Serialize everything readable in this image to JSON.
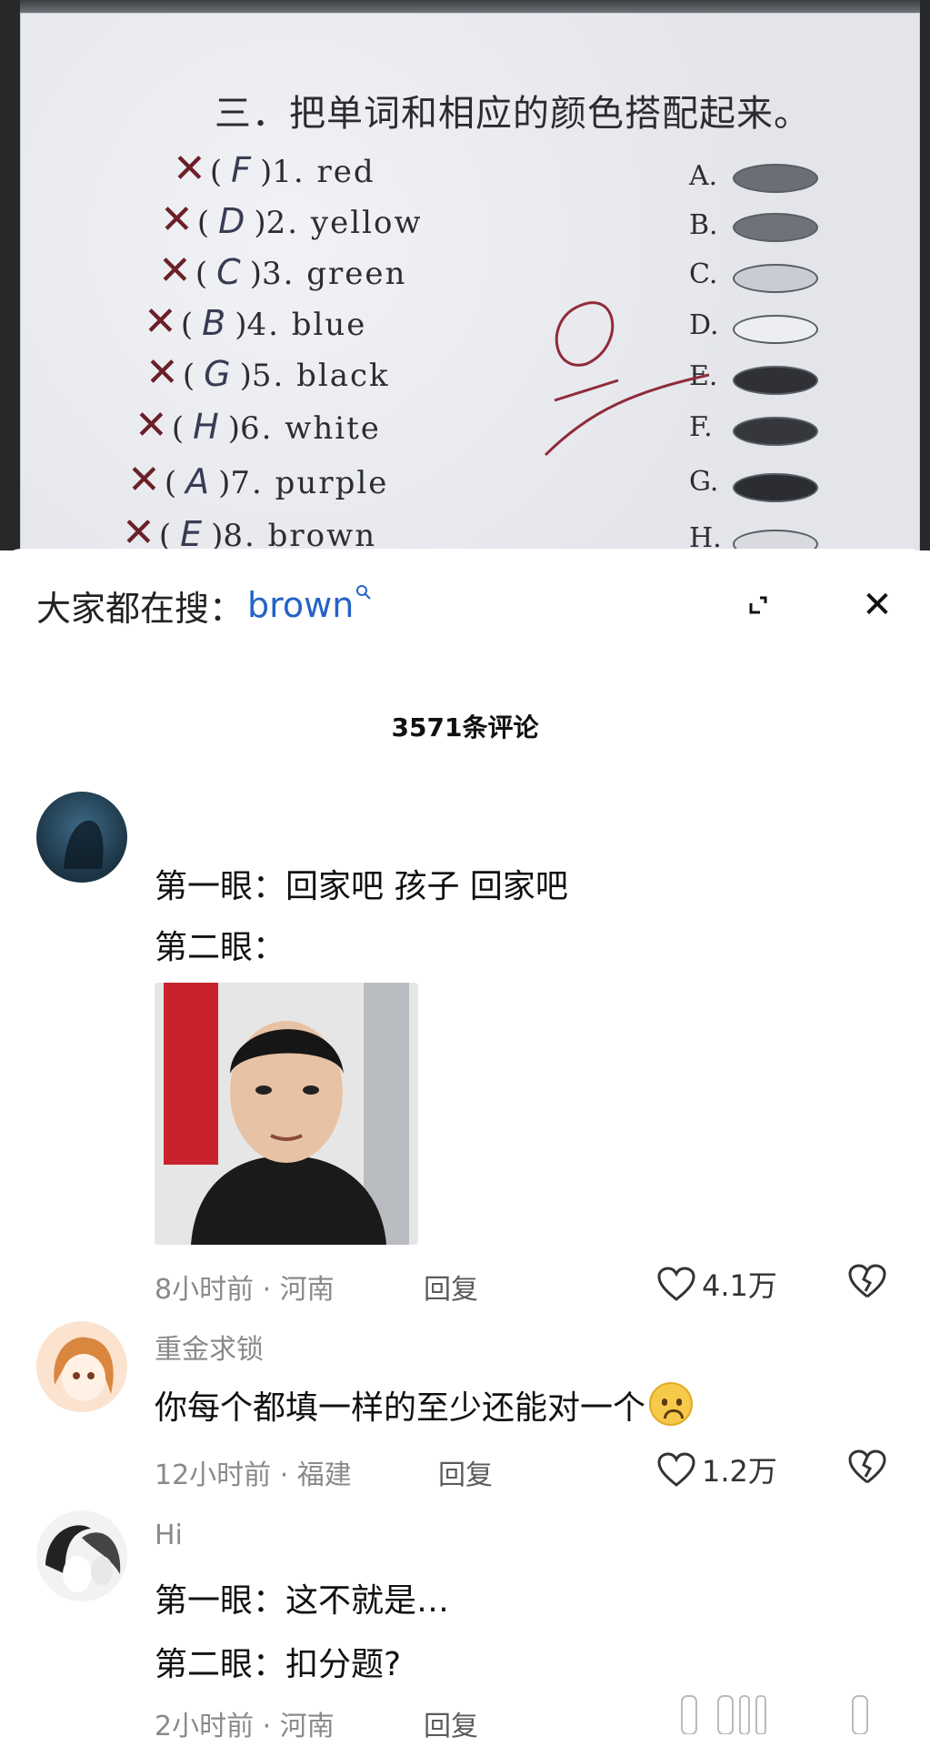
{
  "worksheet": {
    "heading": "三．把单词和相应的颜色搭配起来。",
    "items": [
      {
        "mark": "✕",
        "answer": "F",
        "word": "1. red"
      },
      {
        "mark": "✕",
        "answer": "D",
        "word": "2. yellow"
      },
      {
        "mark": "✕",
        "answer": "C",
        "word": "3. green"
      },
      {
        "mark": "✕",
        "answer": "B",
        "word": "4. blue"
      },
      {
        "mark": "✕",
        "answer": "G",
        "word": "5. black"
      },
      {
        "mark": "✕",
        "answer": "H",
        "word": "6. white"
      },
      {
        "mark": "✕",
        "answer": "A",
        "word": "7. purple"
      },
      {
        "mark": "✕",
        "answer": "E",
        "word": "8. brown"
      }
    ],
    "options": [
      "A.",
      "B.",
      "C.",
      "D.",
      "E.",
      "F.",
      "G.",
      "H."
    ],
    "option_fills": [
      "#6b6e75",
      "#6f7279",
      "#c9ccd2",
      "#eceef1",
      "#2f3136",
      "#35373c",
      "#2b2d32",
      "#d8dadf"
    ],
    "score": "0"
  },
  "panel": {
    "search_prefix": "大家都在搜：",
    "search_term": "brown",
    "search_icon": "search-icon",
    "comment_count": "3571条评论"
  },
  "comments": [
    {
      "lines": [
        "第一眼：回家吧 孩子 回家吧",
        "第二眼："
      ],
      "time": "8小时前 · 河南",
      "reply": "回复",
      "likes": "4.1万"
    },
    {
      "username": "重金求锁",
      "text": "你每个都填一样的至少还能对一个",
      "time": "12小时前 · 福建",
      "reply": "回复",
      "likes": "1.2万"
    },
    {
      "username": "Hi",
      "lines": [
        "第一眼：这不就是…",
        "第二眼：扣分题?"
      ],
      "time": "2小时前 · 河南",
      "reply": "回复"
    }
  ]
}
